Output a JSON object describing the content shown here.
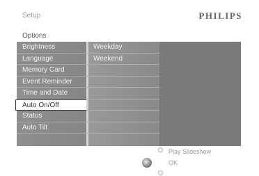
{
  "header": {
    "setup_label": "Setup",
    "brand": "PHILIPS"
  },
  "options_label": "Options",
  "menu": {
    "items": [
      {
        "label": "Brightness"
      },
      {
        "label": "Language"
      },
      {
        "label": "Memory Card"
      },
      {
        "label": "Event Reminder"
      },
      {
        "label": "Time and Date"
      },
      {
        "label": "Auto On/Off"
      },
      {
        "label": "Status"
      },
      {
        "label": "Auto Tilt"
      }
    ],
    "selected": "Auto On/Off"
  },
  "submenu": {
    "items": [
      {
        "label": "Weekday"
      },
      {
        "label": "Weekend"
      }
    ]
  },
  "footer": {
    "play_hint": "Play Slideshow",
    "ok_hint": "OK"
  }
}
